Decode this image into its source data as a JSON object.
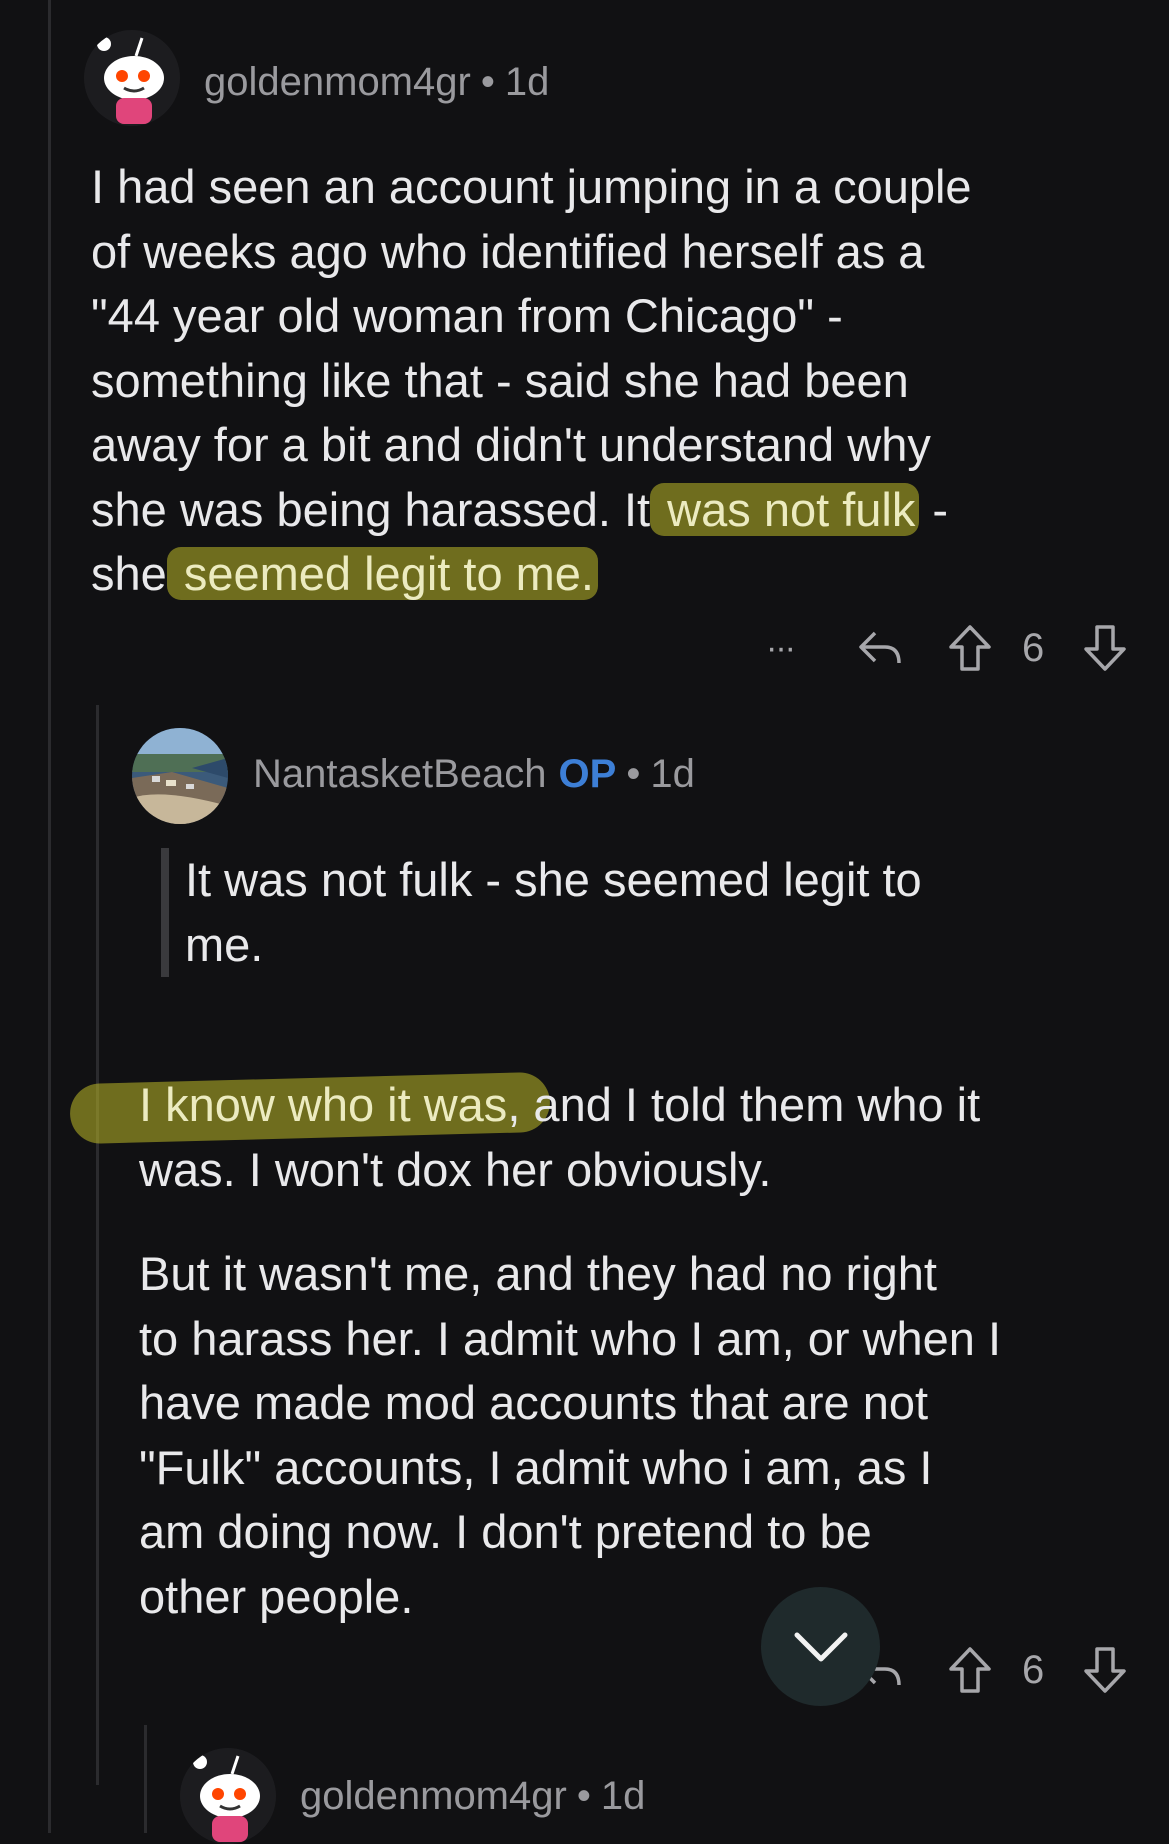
{
  "comments": [
    {
      "author": "goldenmom4gr",
      "time": "1d",
      "lines": [
        "I had seen an account jumping in a couple",
        "of weeks ago who identified herself as a",
        "\"44 year old woman from Chicago\" -",
        "something like that - said she had been",
        "away for a bit and didn't understand why"
      ],
      "line6_pre": "she was being harassed.  It",
      "line6_hl": " was not fulk",
      "line6_post": " -",
      "line7_pre": "she",
      "line7_hl": " seemed legit to me.",
      "score": "6",
      "more_label": "···"
    },
    {
      "author": "NantasketBeach",
      "op_badge": "OP",
      "time": "1d",
      "quote_lines": [
        "It was not fulk - she seemed legit to",
        "me."
      ],
      "p1_hl": "I know who it was",
      "p1_rest": ", and I told them who it",
      "p1_line2": "was. I won't dox her obviously.",
      "p2_lines": [
        "But it wasn't me, and they had no right",
        "to harass her. I admit who I am, or when I",
        "have made mod  accounts that are not",
        "\"Fulk\" accounts, I admit who i am, as I",
        "am doing now. I don't pretend to be",
        "other people."
      ],
      "score": "6"
    },
    {
      "author": "goldenmom4gr",
      "time": "1d"
    }
  ],
  "icons": {
    "reply": "reply-icon",
    "upvote": "upvote-icon",
    "downvote": "downvote-icon",
    "more": "more-icon",
    "scroll_down": "chevron-down-icon"
  },
  "colors": {
    "background": "#111113",
    "op": "#3d7fd6",
    "highlight": "#bdb928"
  }
}
